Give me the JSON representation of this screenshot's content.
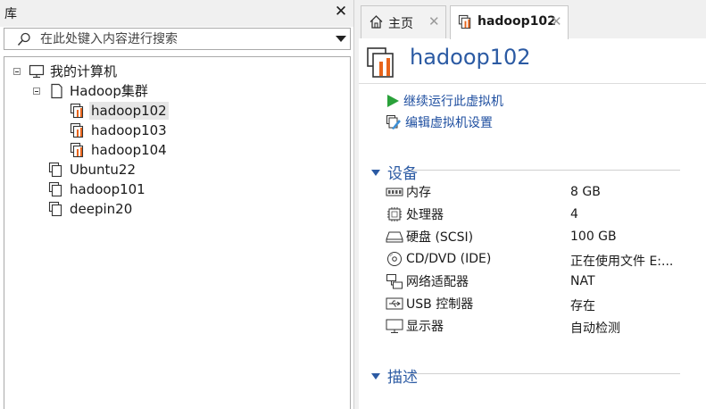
{
  "library": {
    "title": "库",
    "close_glyph": "✕",
    "search_placeholder": "在此处键入内容进行搜索",
    "tree": {
      "root": "我的计算机",
      "group": "Hadoop集群",
      "group_children": [
        "hadoop102",
        "hadoop103",
        "hadoop104"
      ],
      "other_vms": [
        "Ubuntu22",
        "hadoop101",
        "deepin20"
      ]
    },
    "selected": "hadoop102"
  },
  "tabs": [
    {
      "label": "主页",
      "icon": "home-icon",
      "close_glyph": "✕"
    },
    {
      "label": "hadoop102",
      "icon": "vm-running-icon",
      "close_glyph": "✕"
    }
  ],
  "vm": {
    "name": "hadoop102",
    "actions": {
      "resume": "继续运行此虚拟机",
      "edit": "编辑虚拟机设置"
    },
    "devices_header": "设备",
    "devices": [
      {
        "name": "内存",
        "value": "8 GB",
        "icon": "memory-icon"
      },
      {
        "name": "处理器",
        "value": "4",
        "icon": "cpu-icon"
      },
      {
        "name": "硬盘 (SCSI)",
        "value": "100 GB",
        "icon": "harddisk-icon"
      },
      {
        "name": "CD/DVD (IDE)",
        "value": "正在使用文件 E:...",
        "icon": "cd-icon"
      },
      {
        "name": "网络适配器",
        "value": "NAT",
        "icon": "network-icon"
      },
      {
        "name": "USB 控制器",
        "value": "存在",
        "icon": "usb-icon"
      },
      {
        "name": "显示器",
        "value": "自动检测",
        "icon": "monitor-icon"
      }
    ],
    "description_header": "描述"
  },
  "colors": {
    "accent_blue": "#2b5aa3",
    "link_blue": "#1f4fa0",
    "vm_orange": "#e8641b",
    "play_green": "#2aa13a"
  }
}
